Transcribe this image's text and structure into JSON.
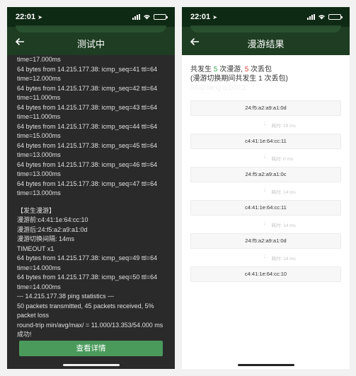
{
  "left": {
    "status_time": "22:01",
    "title": "测试中",
    "log_cut": "time=17.000ms",
    "log_lines": [
      "time=17.000ms",
      "64 bytes from 14.215.177.38: icmp_seq=41 ttl=64",
      "time=12.000ms",
      "64 bytes from 14.215.177.38: icmp_seq=42 ttl=64",
      "time=11.000ms",
      "64 bytes from 14.215.177.38: icmp_seq=43 ttl=64",
      "time=11.000ms",
      "64 bytes from 14.215.177.38: icmp_seq=44 ttl=64",
      "time=15.000ms",
      "64 bytes from 14.215.177.38: icmp_seq=45 ttl=64",
      "time=13.000ms",
      "64 bytes from 14.215.177.38: icmp_seq=46 ttl=64",
      "time=13.000ms",
      "64 bytes from 14.215.177.38: icmp_seq=47 ttl=64",
      "time=13.000ms"
    ],
    "log_lines2": [
      "【发生漫游】",
      "漫游前:c4:41:1e:64:cc:10",
      "漫游后:24:f5:a2:a9:a1:0d",
      "漫游切换间隔: 14ms",
      "TIMEOUT x1",
      "64 bytes from 14.215.177.38: icmp_seq=49 ttl=64",
      "time=14.000ms",
      "64 bytes from 14.215.177.38: icmp_seq=50 ttl=64",
      "time=14.000ms",
      "--- 14.215.177.38 ping statistics ---",
      "50 packets transmitted, 45 packets received, 5%",
      "packet loss",
      "round-trip min/avg/max/ = 11.000/13.353/54.000 ms",
      "成功!"
    ],
    "button_label": "查看详情"
  },
  "right": {
    "status_time": "22:01",
    "title": "漫游结果",
    "summary_prefix": "共发生 ",
    "roam_count": "5",
    "summary_mid": " 次漫游, ",
    "loss_count": "5",
    "summary_suffix": " 次丢包",
    "summary_line2": "(漫游切换期间共发生 1 次丢包)",
    "ghost_text": "SSID:Mr.Q  S:D10:2",
    "nodes": [
      "24:f5:a2:a9:a1:0d",
      "c4:41:1e:64:cc:11",
      "24:f5:a2:a9:a1:0c",
      "c4:41:1e:64:cc:11",
      "24:f5:a2:a9:a1:0d",
      "c4:41:1e:64:cc:10"
    ],
    "durations": [
      "耗时: 19 ms",
      "耗时: 0 ms",
      "耗时: 14 ms",
      "耗时: 14 ms",
      "耗时: 14 ms"
    ]
  },
  "colors": {
    "accent_green": "#4a9a5c",
    "roam_green": "#3aa350",
    "loss_red": "#e0413b",
    "nav_dark": "#1e3d22"
  },
  "icons": [
    "location-arrow-icon",
    "signal-icon",
    "wifi-icon",
    "battery-icon",
    "back-arrow-icon",
    "down-arrow-icon"
  ]
}
